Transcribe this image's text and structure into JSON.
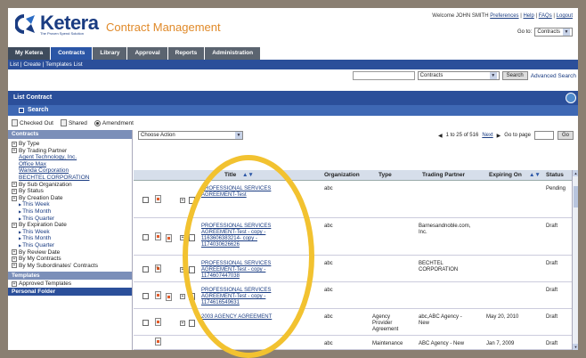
{
  "brand": {
    "name": "Ketera",
    "tagline": "The Proven Spend Solution",
    "app_title": "Contract Management"
  },
  "header": {
    "welcome": "Welcome JOHN SMITH",
    "links": [
      "Preferences",
      "Help",
      "FAQs",
      "Logout"
    ],
    "goto_label": "Go to:",
    "goto_value": "Contracts"
  },
  "tabs": [
    "My Ketera",
    "Contracts",
    "Library",
    "Approval",
    "Reports",
    "Administration"
  ],
  "subnav": "List | Create | Templates List",
  "search": {
    "scope": "Contracts",
    "button": "Search",
    "advanced": "Advanced Search"
  },
  "list_title": "List Contract",
  "search_section": "Search",
  "filters": [
    "Checked Out",
    "Shared",
    "Amendment"
  ],
  "sidebar": {
    "contracts_head": "Contracts",
    "items": [
      {
        "t": "node",
        "label": "By Type"
      },
      {
        "t": "node",
        "label": "By Trading Partner"
      },
      {
        "t": "link",
        "label": "Agent Technology, Inc."
      },
      {
        "t": "link",
        "label": "Office Max"
      },
      {
        "t": "link",
        "label": "Wanda Corporation"
      },
      {
        "t": "link",
        "label": "BECHTEL CORPORATION"
      },
      {
        "t": "node",
        "label": "By Sub Organization"
      },
      {
        "t": "node",
        "label": "By Status"
      },
      {
        "t": "node",
        "label": "By Creation Date"
      },
      {
        "t": "tri",
        "label": "This Week"
      },
      {
        "t": "tri",
        "label": "This Month"
      },
      {
        "t": "tri",
        "label": "This Quarter"
      },
      {
        "t": "node",
        "label": "By Expiration Date"
      },
      {
        "t": "tri",
        "label": "This Week"
      },
      {
        "t": "tri",
        "label": "This Month"
      },
      {
        "t": "tri",
        "label": "This Quarter"
      },
      {
        "t": "node",
        "label": "By Review Date"
      },
      {
        "t": "node",
        "label": "By My Contracts"
      },
      {
        "t": "node",
        "label": "By My Subordinates' Contracts"
      }
    ],
    "templates_head": "Templates",
    "templates_item": "Approved Templates",
    "personal_head": "Personal Folder"
  },
  "toolbar": {
    "action": "Choose Action",
    "range": "1 to 25 of 516",
    "next": "Next",
    "goto": "Go to page",
    "go": "Go"
  },
  "columns": [
    "Title",
    "Organization",
    "Type",
    "Trading Partner",
    "Expiring On",
    "Status"
  ],
  "rows": [
    {
      "title": [
        "PROFESSIONAL SERVICES",
        "AGREEMENT-Test"
      ],
      "org": "abc",
      "type": [],
      "partner": [],
      "exp": "",
      "status": "Pending"
    },
    {
      "title": [
        "PROFESSIONAL SERVICES",
        "AGREEMENT-Test - copy -",
        "1163606383214- copy -",
        "1174030626626"
      ],
      "org": "abc",
      "type": [],
      "partner": [
        "Barnesandnoble.com,",
        "Inc."
      ],
      "exp": "",
      "status": "Draft"
    },
    {
      "title": [
        "PROFESSIONAL SERVICES",
        "AGREEMENT-Test - copy -",
        "1174607447038"
      ],
      "org": "abc",
      "type": [],
      "partner": [
        "BECHTEL",
        "CORPORATION"
      ],
      "exp": "",
      "status": "Draft"
    },
    {
      "title": [
        "PROFESSIONAL SERVICES",
        "AGREEMENT-Test - copy -",
        "1174616549631"
      ],
      "org": "abc",
      "type": [],
      "partner": [],
      "exp": "",
      "status": "Draft"
    },
    {
      "title": [
        "2003 AGENCY AGREEMENT"
      ],
      "org": "abc",
      "type": [
        "Agency",
        "Provider",
        "Agreement"
      ],
      "partner": [
        "abc,ABC Agency -",
        "New"
      ],
      "exp": "May 20, 2010",
      "status": "Draft"
    },
    {
      "title": [],
      "org": "abc",
      "type": [
        "Maintenance"
      ],
      "partner": [
        "ABC Agency - New"
      ],
      "exp": "Jan 7, 2009",
      "status": "Draft"
    }
  ]
}
